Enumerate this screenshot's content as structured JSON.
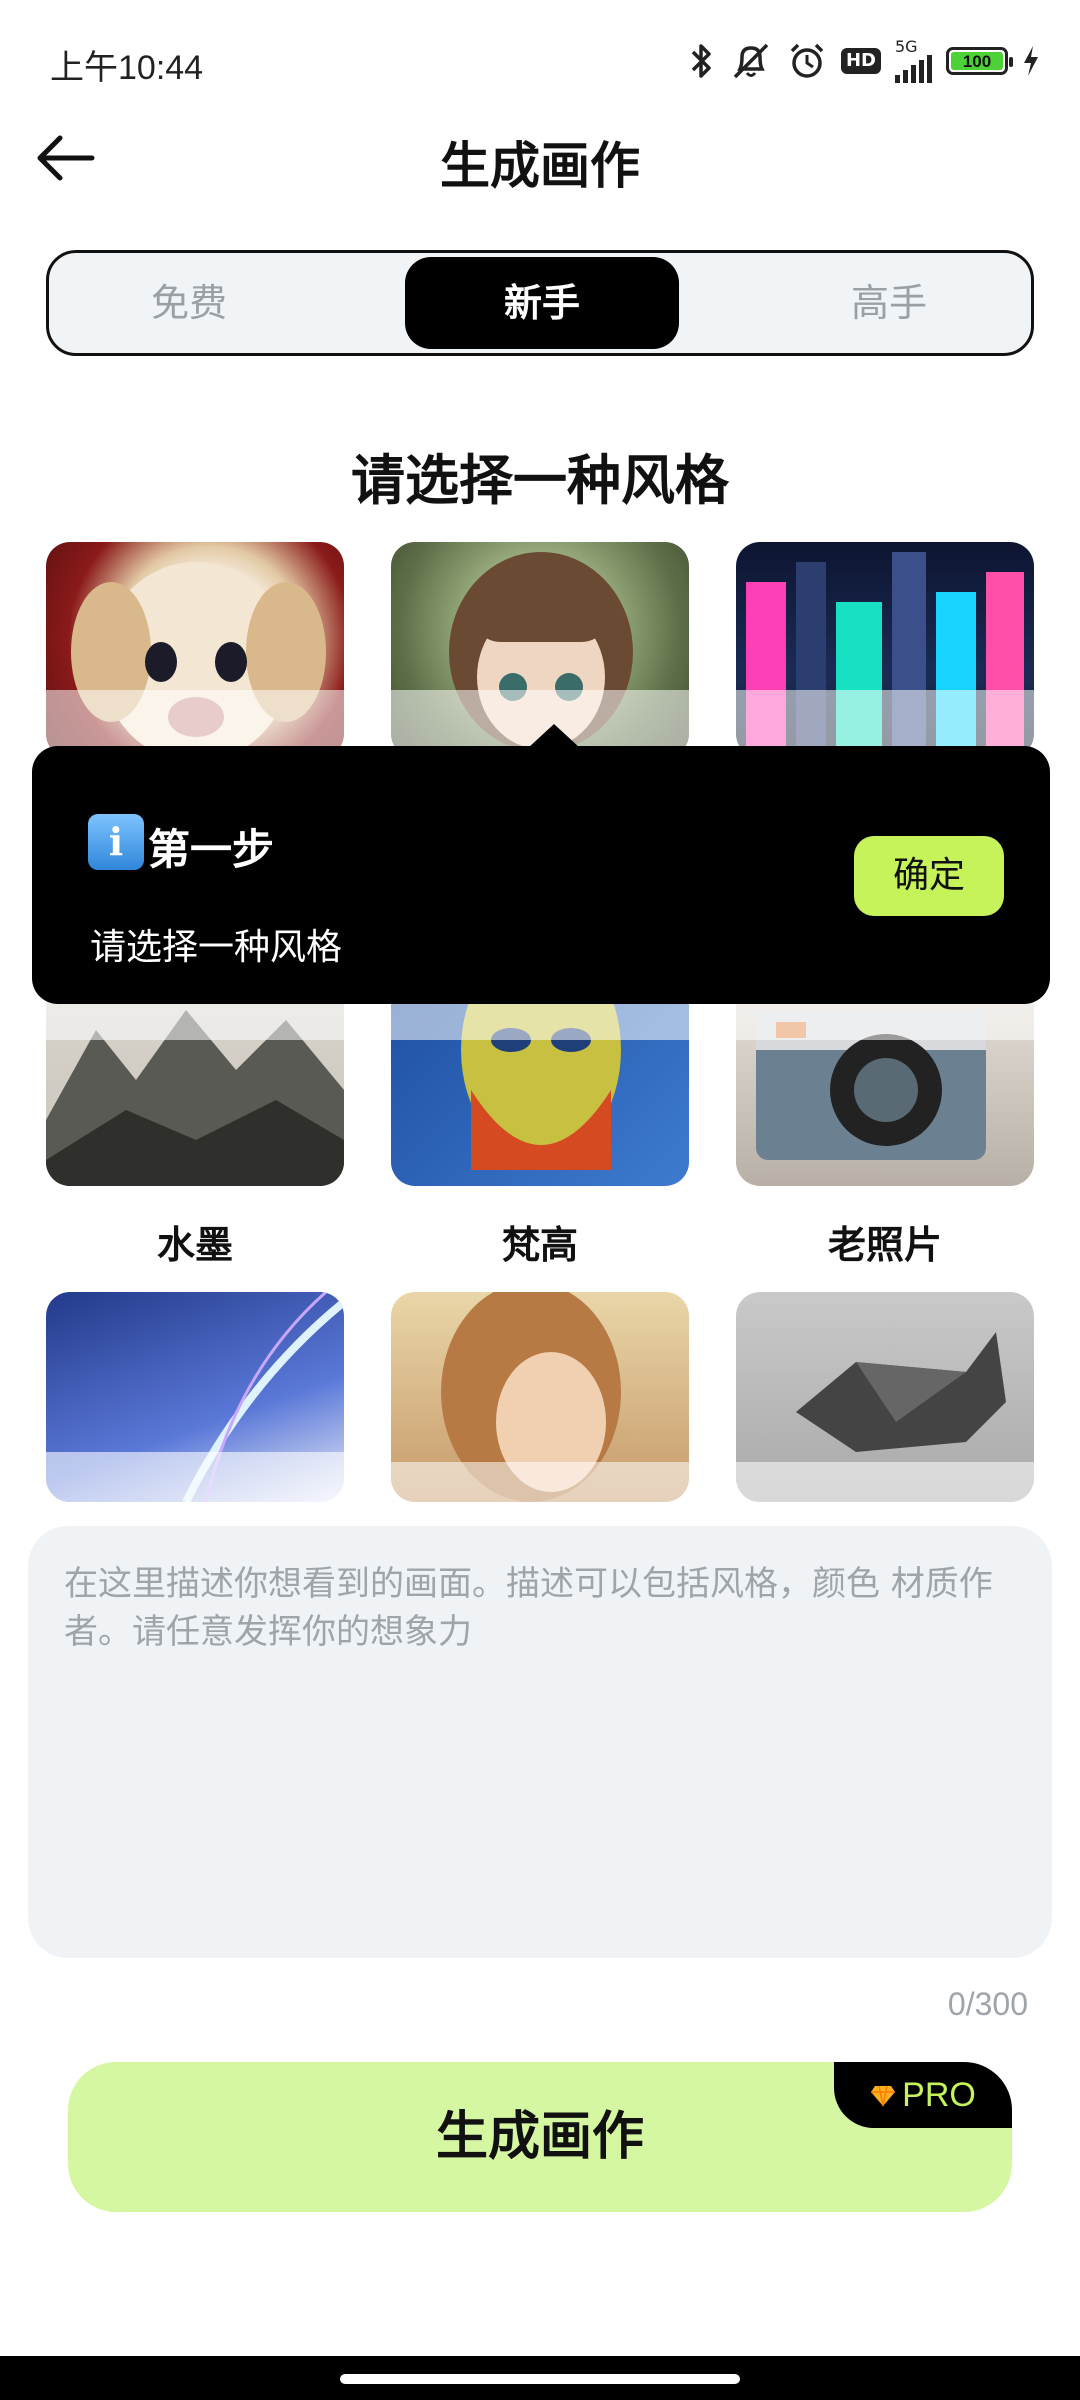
{
  "status_bar": {
    "time": "上午10:44",
    "network": "5G",
    "battery": "100",
    "hd_label": "HD"
  },
  "header": {
    "title": "生成画作"
  },
  "tabs": [
    {
      "label": "免费"
    },
    {
      "label": "新手"
    },
    {
      "label": "高手"
    }
  ],
  "section": {
    "title": "请选择一种风格"
  },
  "styles": [
    {
      "label": "水墨"
    },
    {
      "label": "梵高"
    },
    {
      "label": "老照片"
    }
  ],
  "tooltip": {
    "step": "第一步",
    "description": "请选择一种风格",
    "confirm_label": "确定"
  },
  "prompt": {
    "placeholder": "在这里描述你想看到的画面。描述可以包括风格，颜色 材质作者。请任意发挥你的想象力",
    "counter": "0/300"
  },
  "generate": {
    "label": "生成画作",
    "pro_label": "PRO"
  },
  "colors": {
    "accent": "#c6f35a",
    "button_bg": "#d6f7a2",
    "field_bg": "#f0f3f6"
  }
}
